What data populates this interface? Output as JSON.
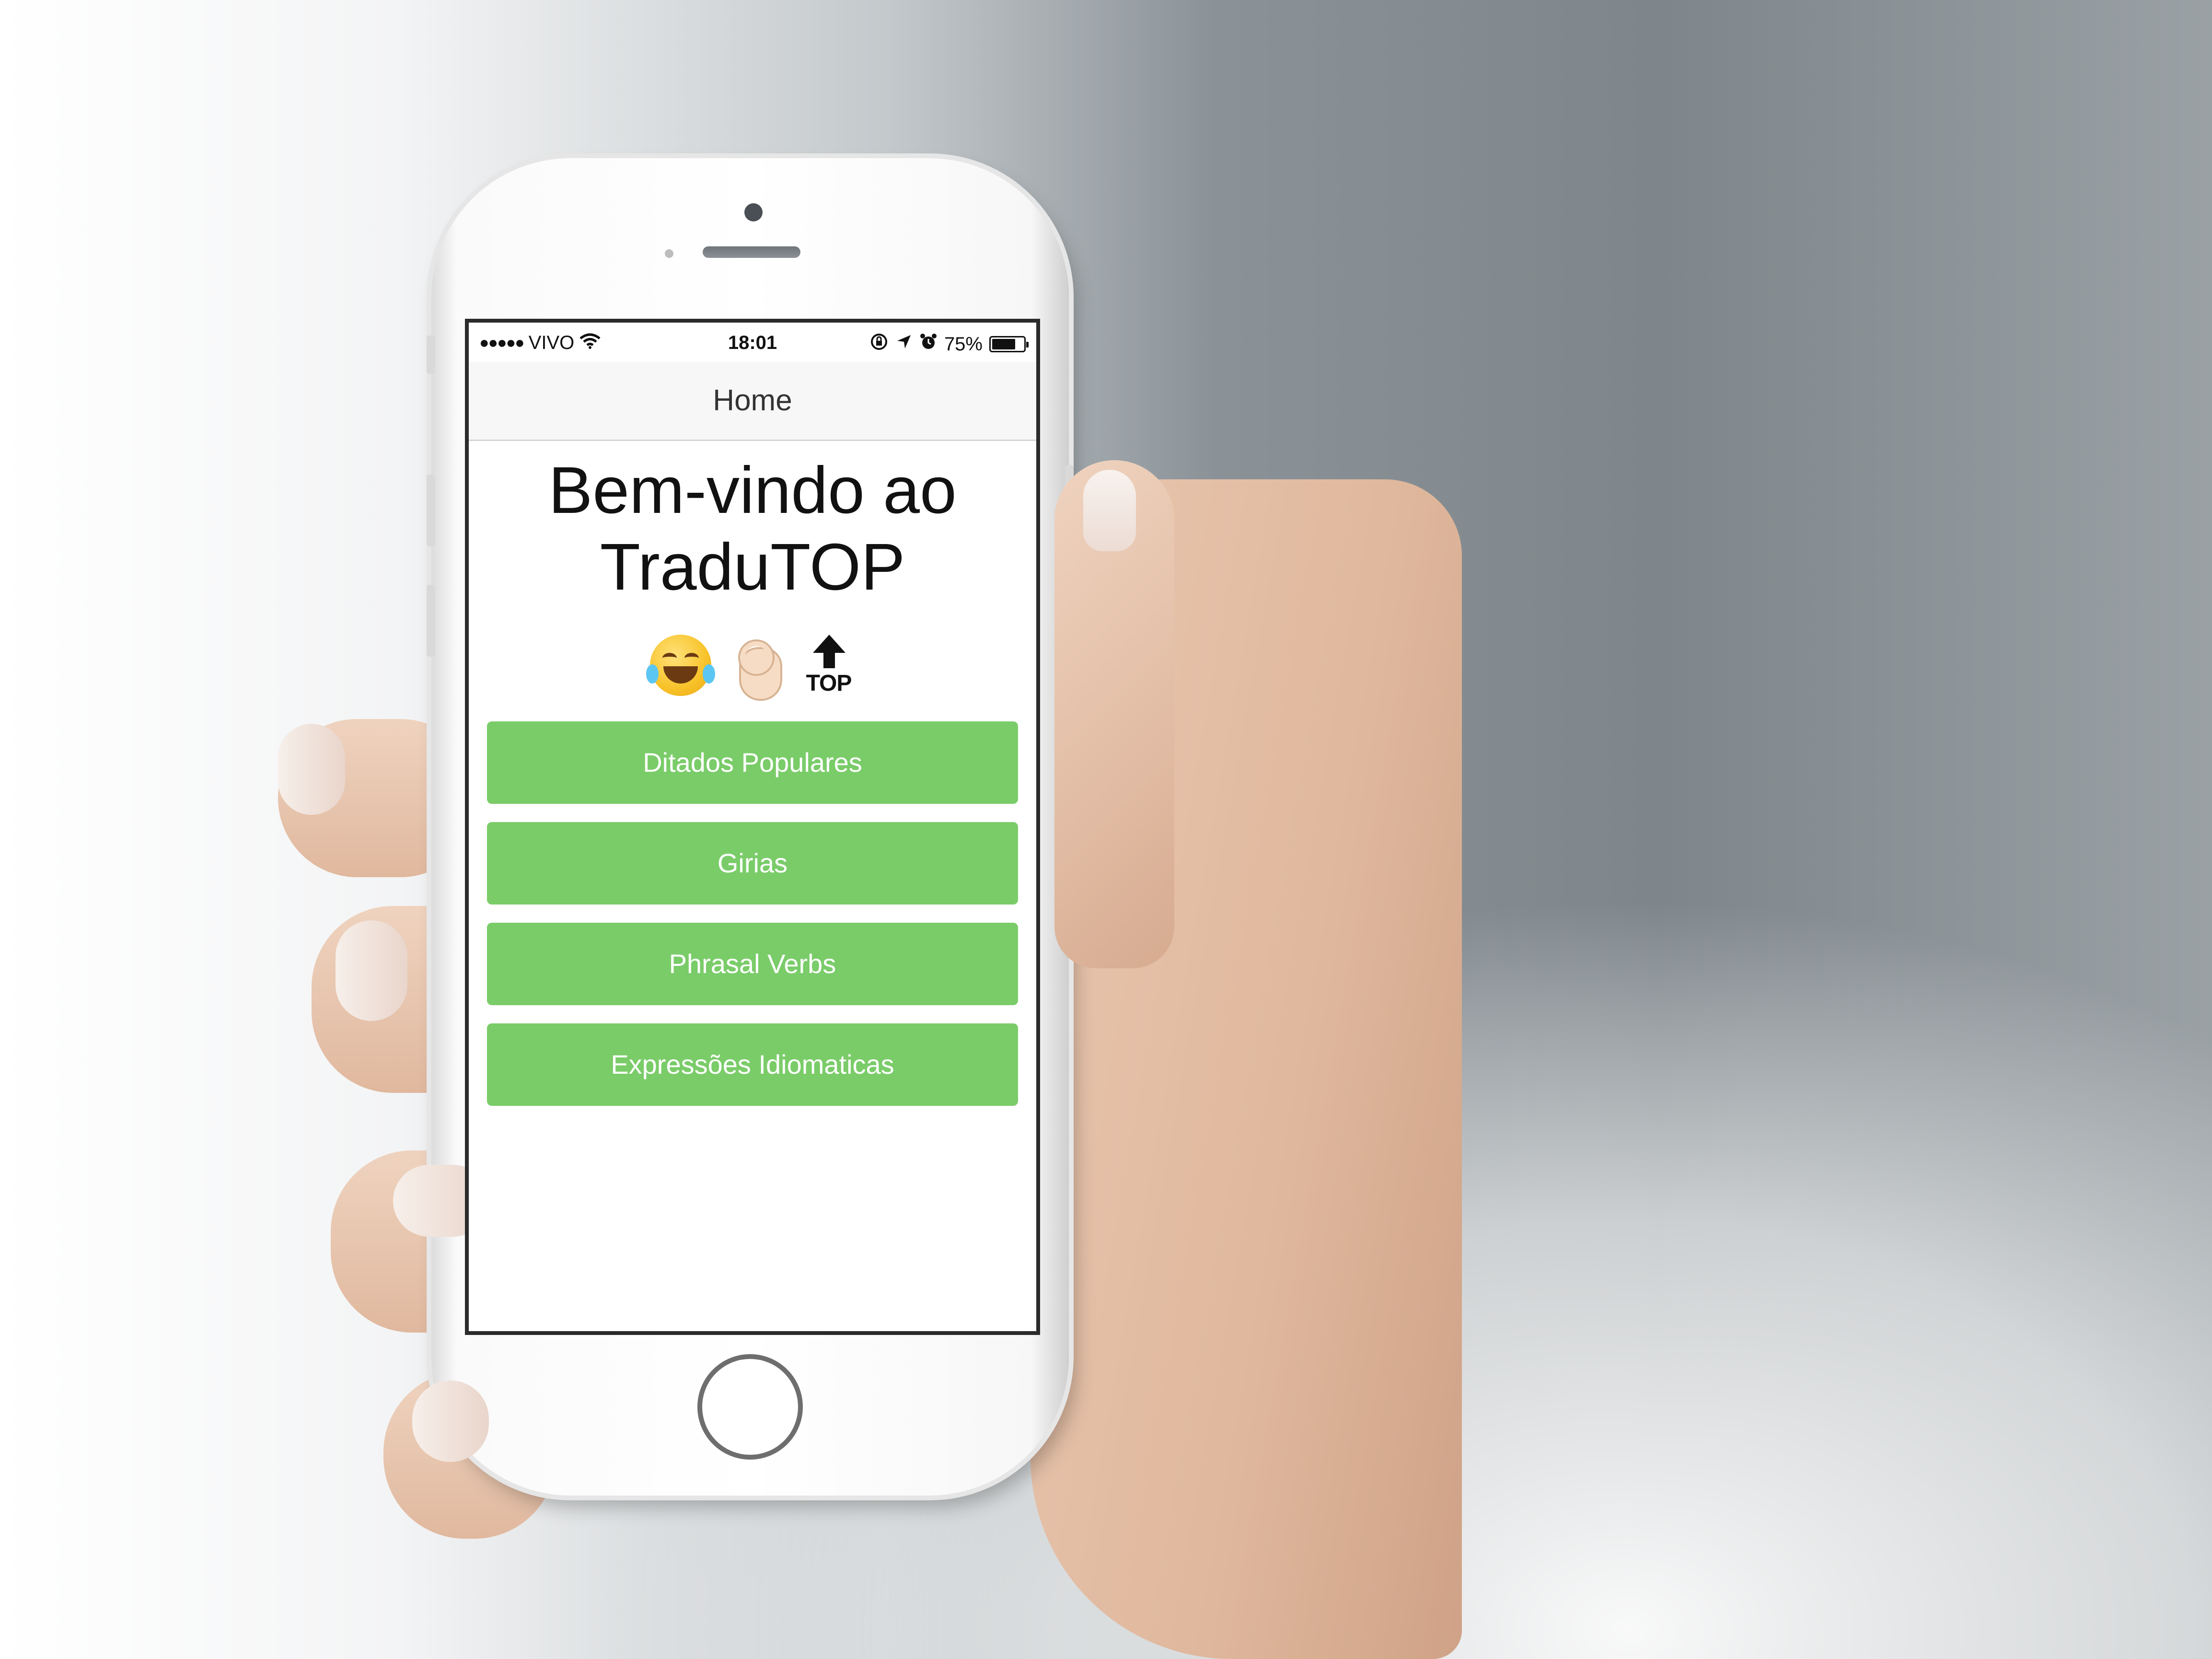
{
  "status_bar": {
    "signal_dots": "●●●●●",
    "carrier": "VIVO",
    "time": "18:01",
    "battery": "75%",
    "battery_level": 0.75,
    "icons": [
      "wifi-icon",
      "orientation-lock-icon",
      "location-arrow-icon",
      "alarm-icon",
      "battery-icon"
    ]
  },
  "nav": {
    "title": "Home"
  },
  "main": {
    "welcome_line1": "Bem-vindo ao",
    "welcome_line2": "TraduTOP",
    "emojis": [
      "face-with-tears-of-joy-emoji",
      "ok-hand-emoji",
      "top-arrow-emoji"
    ],
    "top_emoji_text": "TOP",
    "buttons": [
      {
        "label": "Ditados Populares"
      },
      {
        "label": "Girias"
      },
      {
        "label": "Phrasal Verbs"
      },
      {
        "label": "Expressões Idiomaticas"
      }
    ]
  },
  "colors": {
    "button_green": "#7acc69",
    "nav_background": "#f7f7f7",
    "screen_background": "#ffffff"
  }
}
